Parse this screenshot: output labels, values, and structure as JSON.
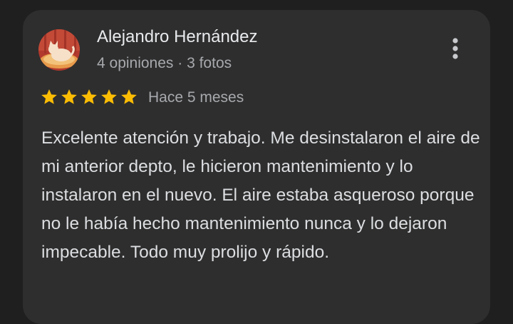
{
  "review": {
    "author_name": "Alejandro Hernández",
    "author_meta": "4 opiniones · 3 fotos",
    "rating": 5,
    "rating_max": 5,
    "date": "Hace 5 meses",
    "text": "Excelente atención y trabajo. Me desinstalaron el aire de mi anterior depto, le hicieron mantenimiento y lo instalaron en el nuevo. El aire estaba asqueroso porque no le había hecho mantenimiento nunca y lo dejaron impecable. Todo muy prolijo y rápido."
  },
  "icons": {
    "avatar": "cat-photo-avatar",
    "menu": "more-vert-icon",
    "star": "star-icon"
  },
  "colors": {
    "background": "#1f1f1f",
    "card": "#2e2e2e",
    "star": "#fbbc04",
    "text_primary": "#e8eaed",
    "text_secondary": "#a7a9ad"
  }
}
